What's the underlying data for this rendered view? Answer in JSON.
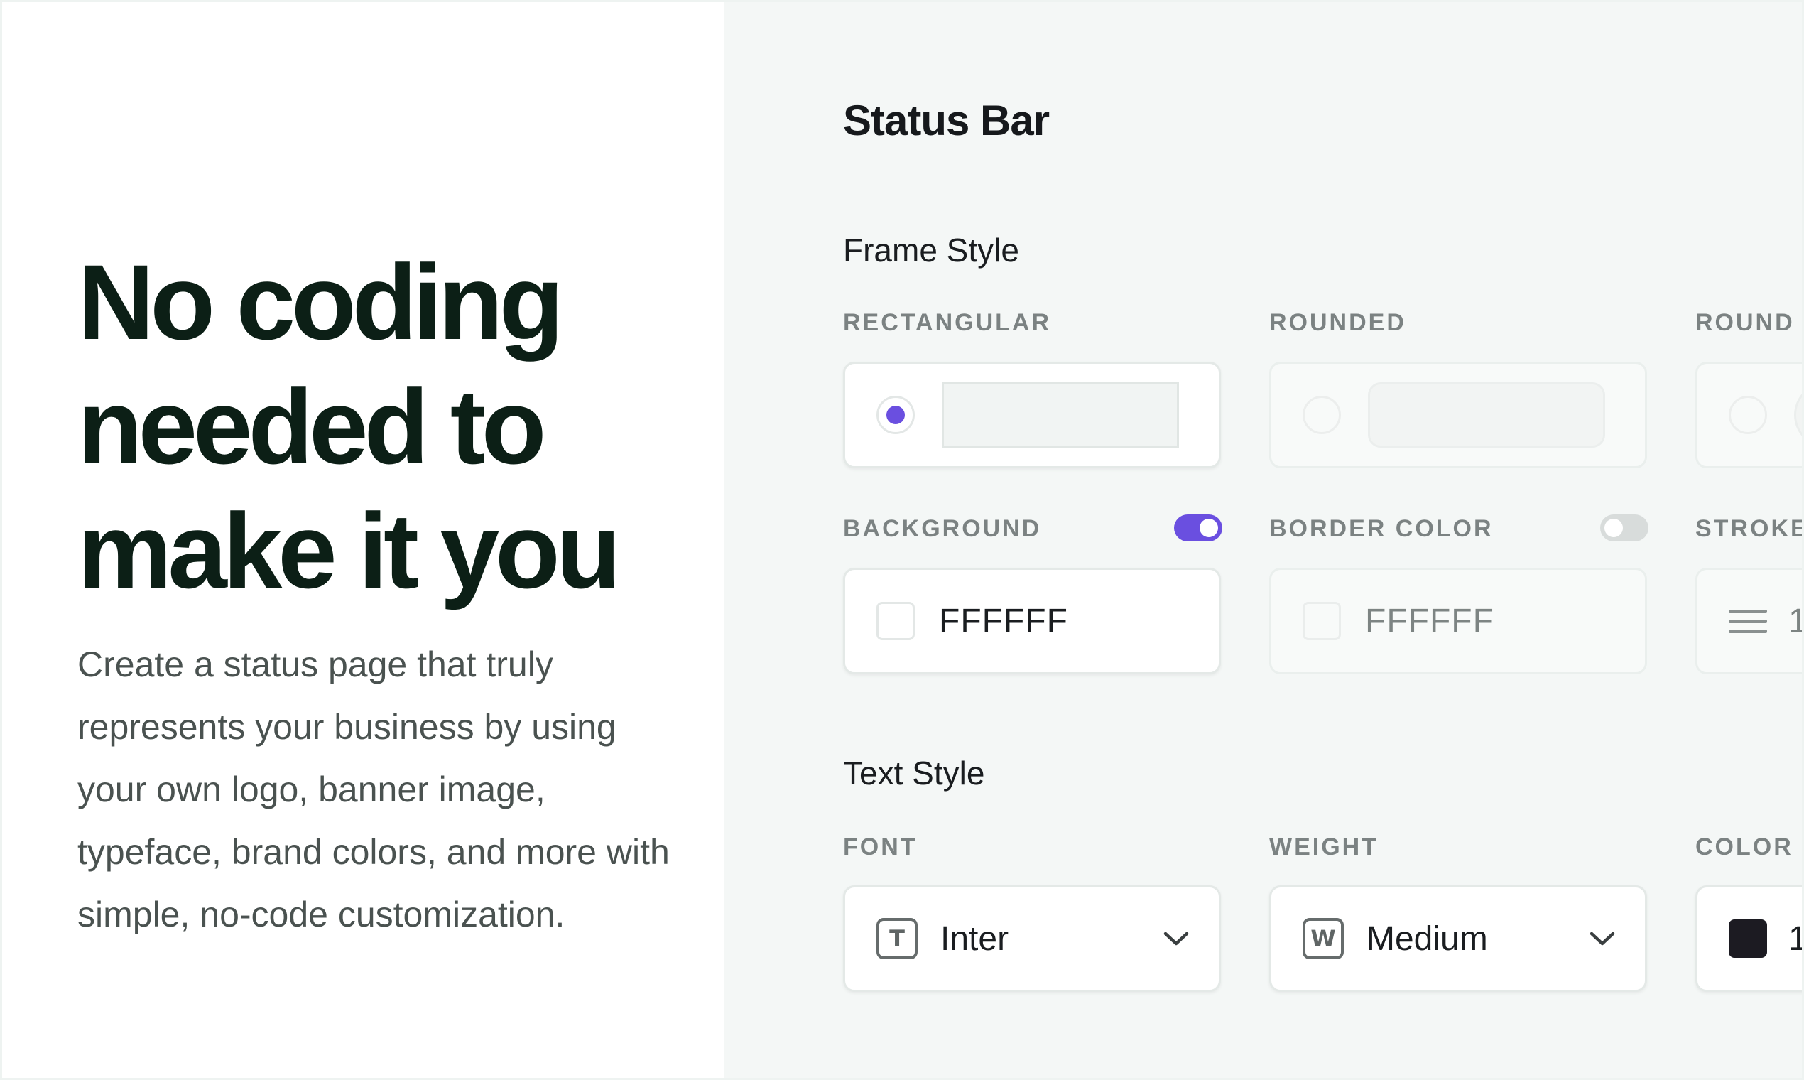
{
  "hero": {
    "headline_lines": [
      "No coding",
      "needed to",
      "make it you"
    ],
    "description": "Create a status page that truly represents your business by using your own logo, banner image, typeface, brand colors, and more with simple, no-code customization."
  },
  "editor": {
    "title": "Status Bar",
    "frame_style": {
      "heading": "Frame Style",
      "options": [
        {
          "label": "RECTANGULAR",
          "selected": true
        },
        {
          "label": "ROUNDED",
          "selected": false
        },
        {
          "label": "ROUND",
          "selected": false
        }
      ]
    },
    "background": {
      "label": "BACKGROUND",
      "enabled": true,
      "value": "FFFFFF"
    },
    "border_color": {
      "label": "BORDER COLOR",
      "enabled": false,
      "value": "FFFFFF"
    },
    "stroke": {
      "label": "STROKE",
      "value": "1"
    },
    "text_style": {
      "heading": "Text Style",
      "font": {
        "label": "FONT",
        "value": "Inter",
        "icon_letter": "T"
      },
      "weight": {
        "label": "WEIGHT",
        "value": "Medium",
        "icon_letter": "W"
      },
      "color": {
        "label": "COLOR",
        "value": "1",
        "swatch": "#1c1b22"
      }
    }
  },
  "colors": {
    "accent": "#6a4fe0",
    "headline": "#0c1f16",
    "panel_bg": "#f4f7f6"
  }
}
